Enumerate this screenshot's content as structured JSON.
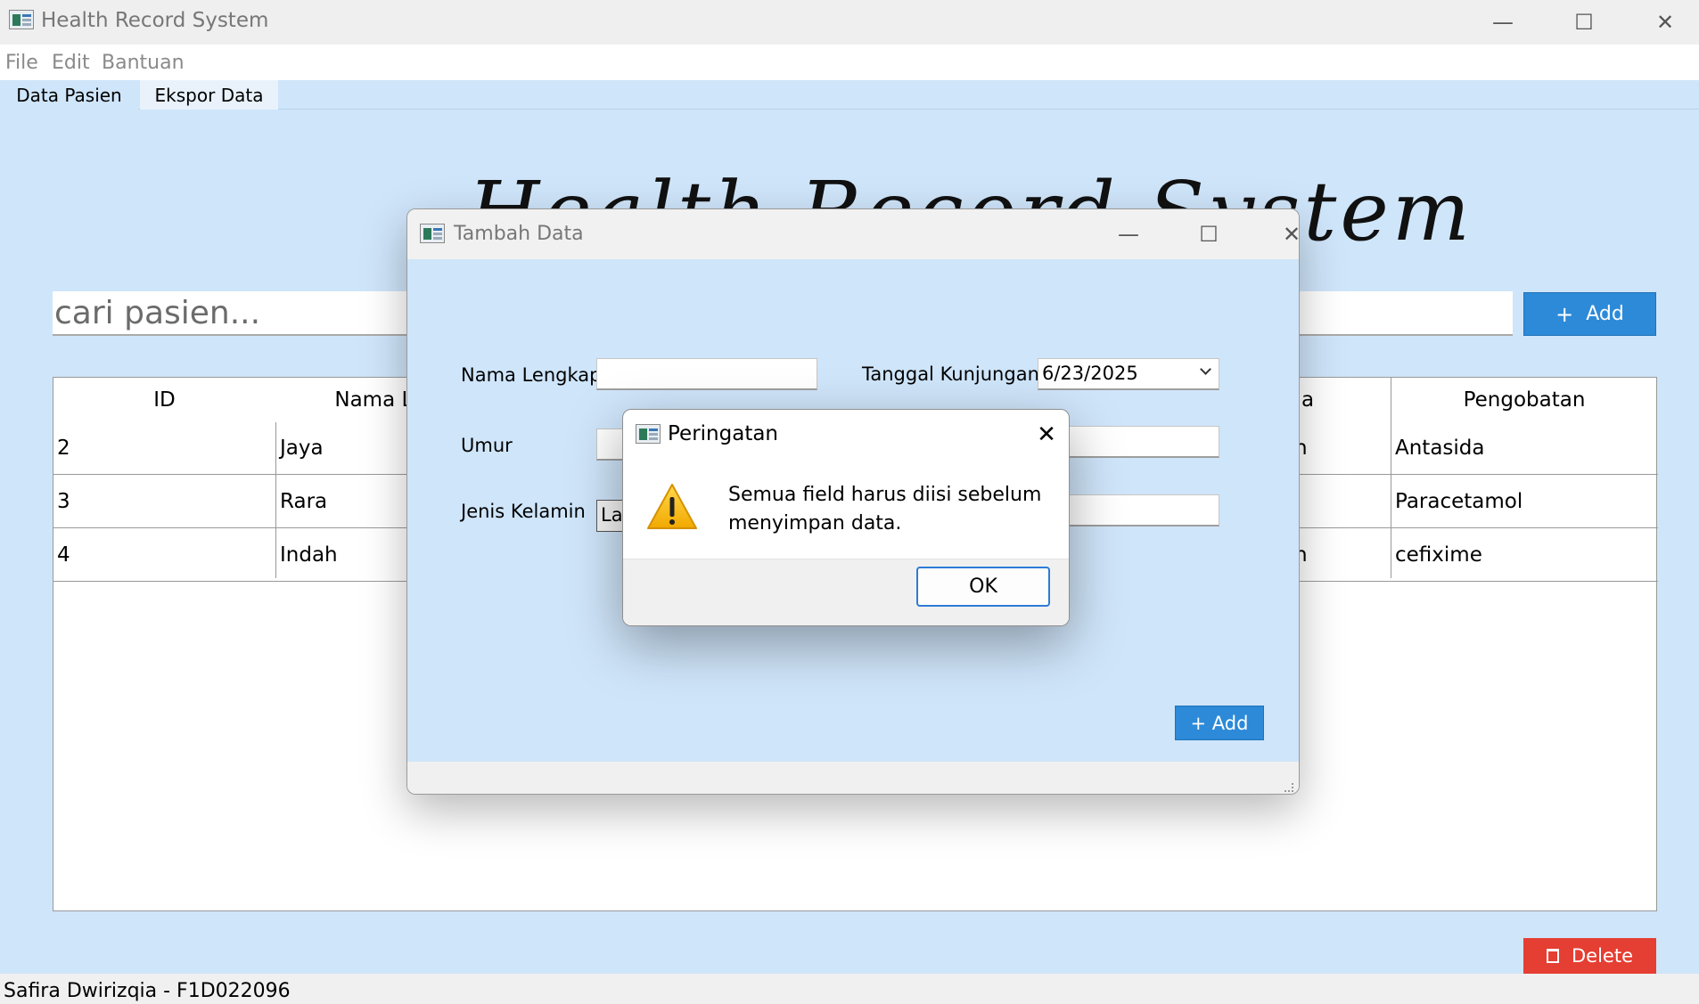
{
  "window": {
    "title": "Health Record System",
    "minimize": "—",
    "maximize": "☐",
    "close": "✕"
  },
  "menu": [
    "File",
    "Edit",
    "Bantuan"
  ],
  "tabs": [
    "Data Pasien",
    "Ekspor Data"
  ],
  "heading": "Health Record System",
  "search": {
    "placeholder": "cari pasien..."
  },
  "add_button": {
    "icon": "+",
    "label": "Add"
  },
  "delete_button": {
    "label": "Delete"
  },
  "table": {
    "headers": [
      "ID",
      "Nama Len",
      "a",
      "Pengobatan"
    ],
    "rows": [
      {
        "id": "2",
        "nama": "Jaya",
        "tail": "n",
        "pengobatan": "Antasida"
      },
      {
        "id": "3",
        "nama": "Rara",
        "tail": "",
        "pengobatan": "Paracetamol"
      },
      {
        "id": "4",
        "nama": "Indah",
        "tail": "n",
        "pengobatan": "cefixime"
      }
    ]
  },
  "status": "Safira Dwirizqia - F1D022096",
  "dialog": {
    "title": "Tambah Data",
    "labels": {
      "nama": "Nama Lengkap",
      "umur": "Umur",
      "jenis": "Jenis Kelamin",
      "tanggal": "Tanggal Kunjungan"
    },
    "values": {
      "nama": "",
      "umur": "",
      "jenis": "Lak",
      "tanggal": "6/23/2025"
    },
    "add_label": "+ Add"
  },
  "message": {
    "title": "Peringatan",
    "text": "Semua field harus diisi sebelum menyimpan data.",
    "ok": "OK",
    "icon": "warning-icon"
  },
  "colors": {
    "accent": "#2c8ad8",
    "danger": "#e53e33",
    "background": "#cfe5fa"
  }
}
